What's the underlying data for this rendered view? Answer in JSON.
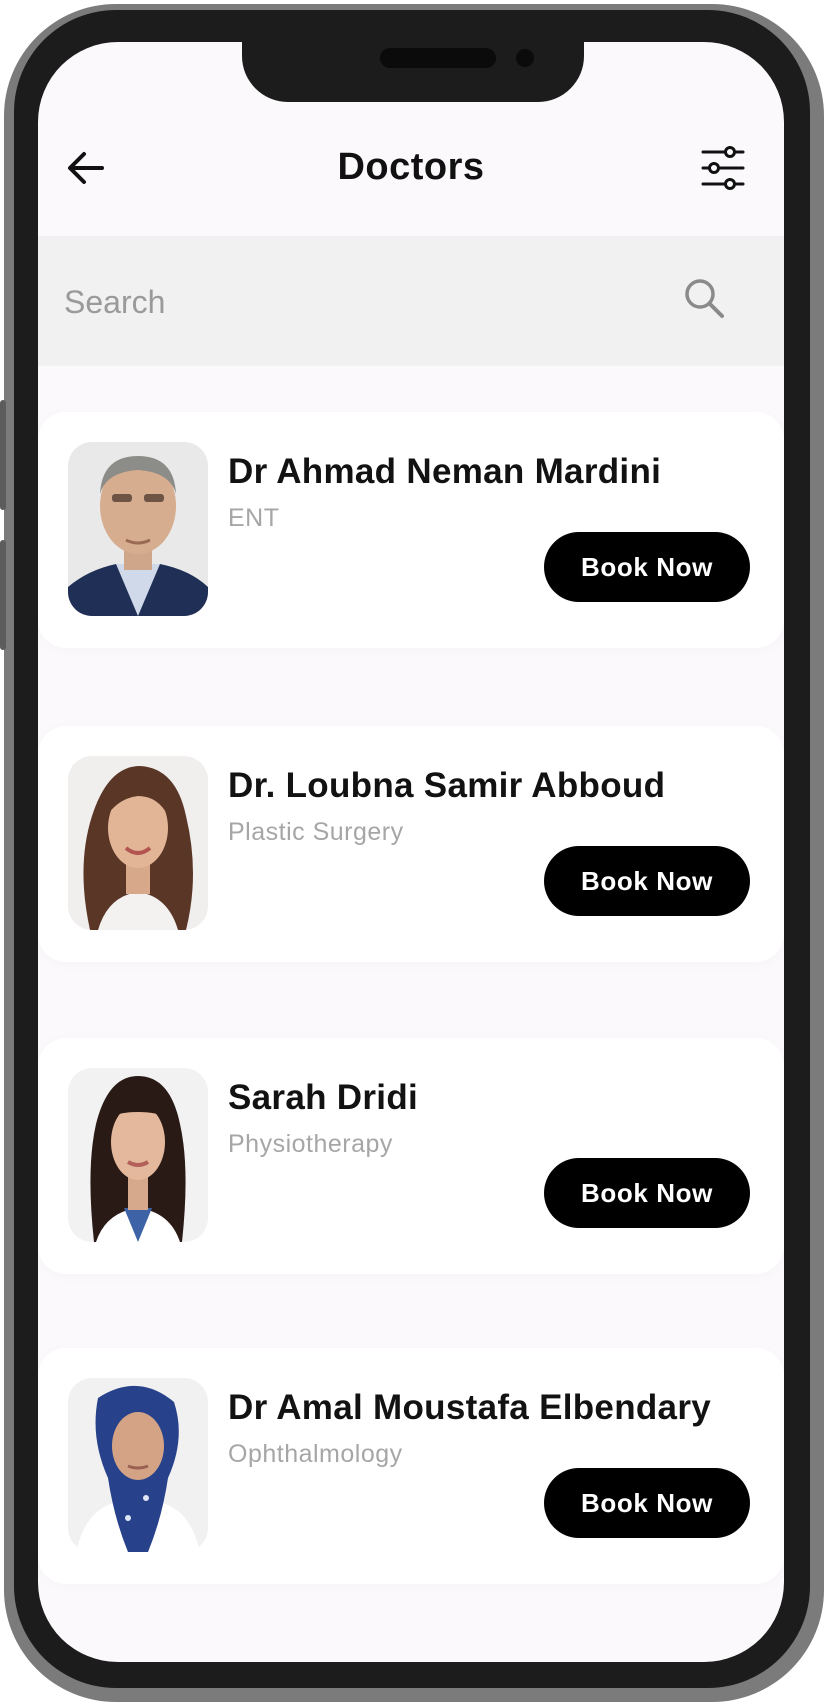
{
  "header": {
    "title": "Doctors",
    "back_icon": "arrow-left-icon",
    "filter_icon": "sliders-icon"
  },
  "search": {
    "placeholder": "Search",
    "value": "",
    "icon": "search-icon"
  },
  "doctors": [
    {
      "name": "Dr Ahmad Neman Mardini",
      "specialty": "ENT",
      "button_label": "Book Now"
    },
    {
      "name": "Dr. Loubna Samir Abboud",
      "specialty": "Plastic Surgery",
      "button_label": "Book Now"
    },
    {
      "name": "Sarah Dridi",
      "specialty": "Physiotherapy",
      "button_label": "Book Now"
    },
    {
      "name": "Dr Amal Moustafa Elbendary",
      "specialty": "Ophthalmology",
      "button_label": "Book Now"
    }
  ],
  "colors": {
    "screen_bg": "#fbf9fb",
    "card_bg": "#ffffff",
    "search_bg": "#f1f1f1",
    "button_bg": "#000000",
    "button_text": "#ffffff",
    "specialty_text": "#a6a6a6"
  }
}
